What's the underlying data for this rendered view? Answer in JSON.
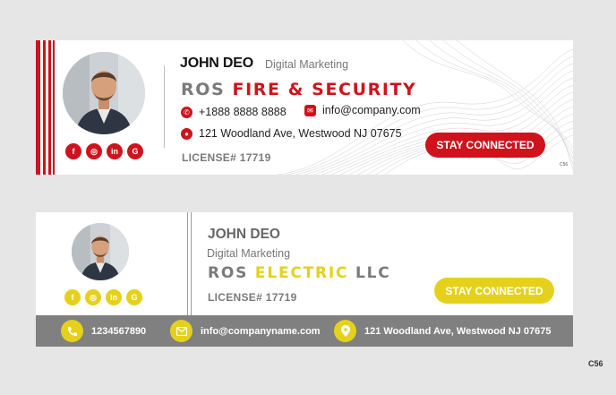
{
  "card1": {
    "name": "JOHN DEO",
    "role": "Digital Marketing",
    "company_prefix": "ROS",
    "company_highlight": "FIRE & SECURITY",
    "phone": "+1888 8888 8888",
    "email": "info@company.com",
    "address": "121 Woodland Ave, Westwood NJ 07675",
    "license": "LICENSE# 17719",
    "button": "STAY CONNECTED",
    "code": "C56",
    "social": [
      {
        "icon": "facebook-icon",
        "glyph": "f"
      },
      {
        "icon": "instagram-icon",
        "glyph": "◎"
      },
      {
        "icon": "linkedin-icon",
        "glyph": "in"
      },
      {
        "icon": "google-icon",
        "glyph": "G"
      }
    ],
    "accent_color": "#d0121c"
  },
  "card2": {
    "name": "JOHN DEO",
    "role": "Digital Marketing",
    "company_prefix": "ROS",
    "company_highlight": "ELECTRIC",
    "company_suffix": "LLC",
    "license": "LICENSE# 17719",
    "button": "STAY CONNECTED",
    "phone": "1234567890",
    "email": "info@companyname.com",
    "address": "121 Woodland Ave, Westwood NJ 07675",
    "social": [
      {
        "icon": "facebook-icon",
        "glyph": "f"
      },
      {
        "icon": "instagram-icon",
        "glyph": "◎"
      },
      {
        "icon": "linkedin-icon",
        "glyph": "in"
      },
      {
        "icon": "google-icon",
        "glyph": "G"
      }
    ],
    "accent_color": "#e5d11c",
    "bar_color": "#808080"
  },
  "footer_code": "C56"
}
